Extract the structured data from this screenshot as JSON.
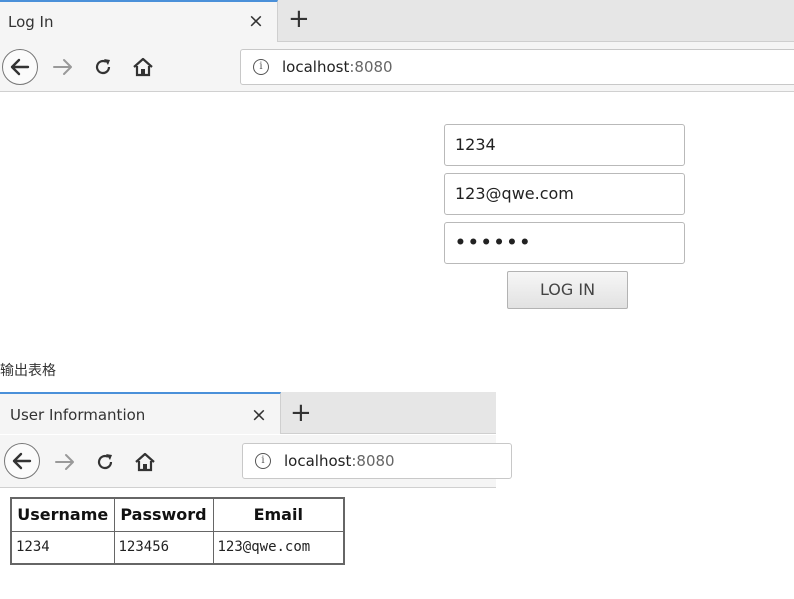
{
  "window1": {
    "tab_title": "Log In",
    "close_glyph": "×",
    "newtab_glyph": "+",
    "url_host": "localhost",
    "url_port": ":8080"
  },
  "form": {
    "username_value": "1234",
    "email_value": "123@qwe.com",
    "password_value": "••••••",
    "login_label": "LOG IN"
  },
  "caption": "输出表格",
  "window2": {
    "tab_title": "User Informantion",
    "close_glyph": "×",
    "newtab_glyph": "+",
    "url_host": "localhost",
    "url_port": ":8080"
  },
  "table": {
    "headers": [
      "Username",
      "Password",
      "Email"
    ],
    "rows": [
      [
        "1234",
        "123456",
        "123@qwe.com"
      ]
    ]
  },
  "icons": {
    "back": "back-arrow-icon",
    "forward": "forward-arrow-icon",
    "reload": "reload-icon",
    "home": "home-icon",
    "info": "info-icon"
  }
}
